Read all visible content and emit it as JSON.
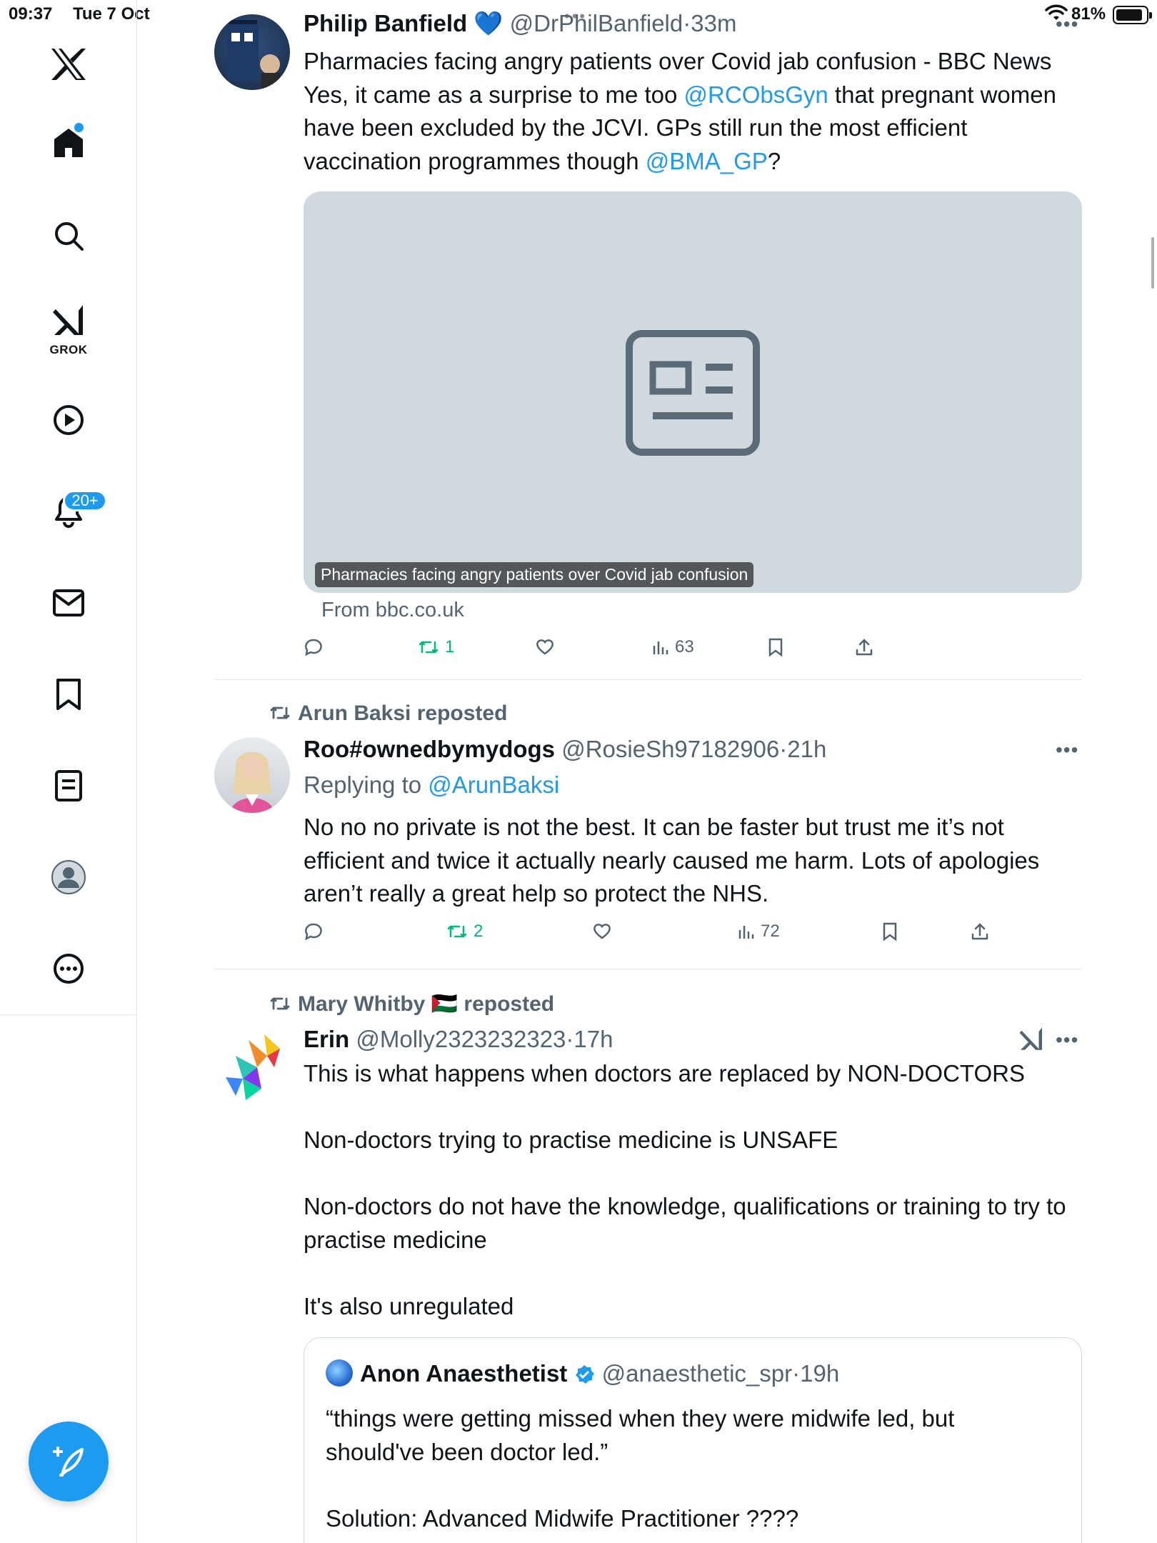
{
  "status_bar": {
    "time": "09:37",
    "date": "Tue 7 Oct",
    "battery_pct": "81%"
  },
  "sidebar": {
    "items": [
      {
        "name": "x-logo-icon"
      },
      {
        "name": "home-icon",
        "active": true
      },
      {
        "name": "search-icon"
      },
      {
        "name": "grok-icon",
        "label": "GROK"
      },
      {
        "name": "video-icon"
      },
      {
        "name": "notifications-icon",
        "badge": "20+"
      },
      {
        "name": "messages-icon"
      },
      {
        "name": "bookmarks-icon"
      },
      {
        "name": "lists-icon"
      },
      {
        "name": "profile-icon"
      },
      {
        "name": "more-icon"
      }
    ],
    "accent": "#1d9bf0"
  },
  "tweets": [
    {
      "name": "Philip Banfield",
      "handle": "@DrPhilBanfield",
      "time": "33m",
      "heart_emoji": "💙",
      "body": {
        "p1": "Pharmacies facing angry patients over Covid jab confusion - BBC News",
        "p2a": "Yes, it came as a surprise to me too ",
        "mention1": "@RCObsGyn",
        "p2b": " that pregnant women have been excluded by the JCVI. GPs still run the most efficient vaccination programmes though ",
        "mention2": "@BMA_GP",
        "p2c": "?"
      },
      "card": {
        "caption": "Pharmacies facing angry patients over Covid jab confusion",
        "source": "From bbc.co.uk"
      },
      "stats": {
        "replies": "",
        "reposts": "1",
        "likes": "",
        "views": "63"
      }
    },
    {
      "reposted_by": "Arun Baksi reposted",
      "name": "Roo#ownedbymydogs",
      "handle": "@RosieSh97182906",
      "time": "21h",
      "replying_label": "Replying to ",
      "replying_to": "@ArunBaksi",
      "body": "No no no private is not the best. It can be faster but trust me it’s not efficient and twice it actually nearly caused me harm. Lots of apologies aren’t really a great help so protect the NHS.",
      "stats": {
        "replies": "",
        "reposts": "2",
        "likes": "",
        "views": "72"
      }
    },
    {
      "reposted_by_name": "Mary Whitby",
      "reposted_flag": "🇵🇸",
      "reposted_suffix": "reposted",
      "name": "Erin",
      "handle": "@Molly2323232323",
      "time": "17h",
      "body": {
        "p1": "This is what happens when doctors are replaced by NON-DOCTORS",
        "p2": "Non-doctors trying to practise medicine is UNSAFE",
        "p3": "Non-doctors do not have the knowledge, qualifications or training to try to practise medicine",
        "p4": "It's also unregulated"
      },
      "quote": {
        "name": "Anon Anaesthetist",
        "handle": "@anaesthetic_spr",
        "time": "19h",
        "p1": "“things were getting missed when they were midwife led, but should've been doctor led.”",
        "p2": "Solution: Advanced Midwife Practitioner ????"
      }
    }
  ]
}
